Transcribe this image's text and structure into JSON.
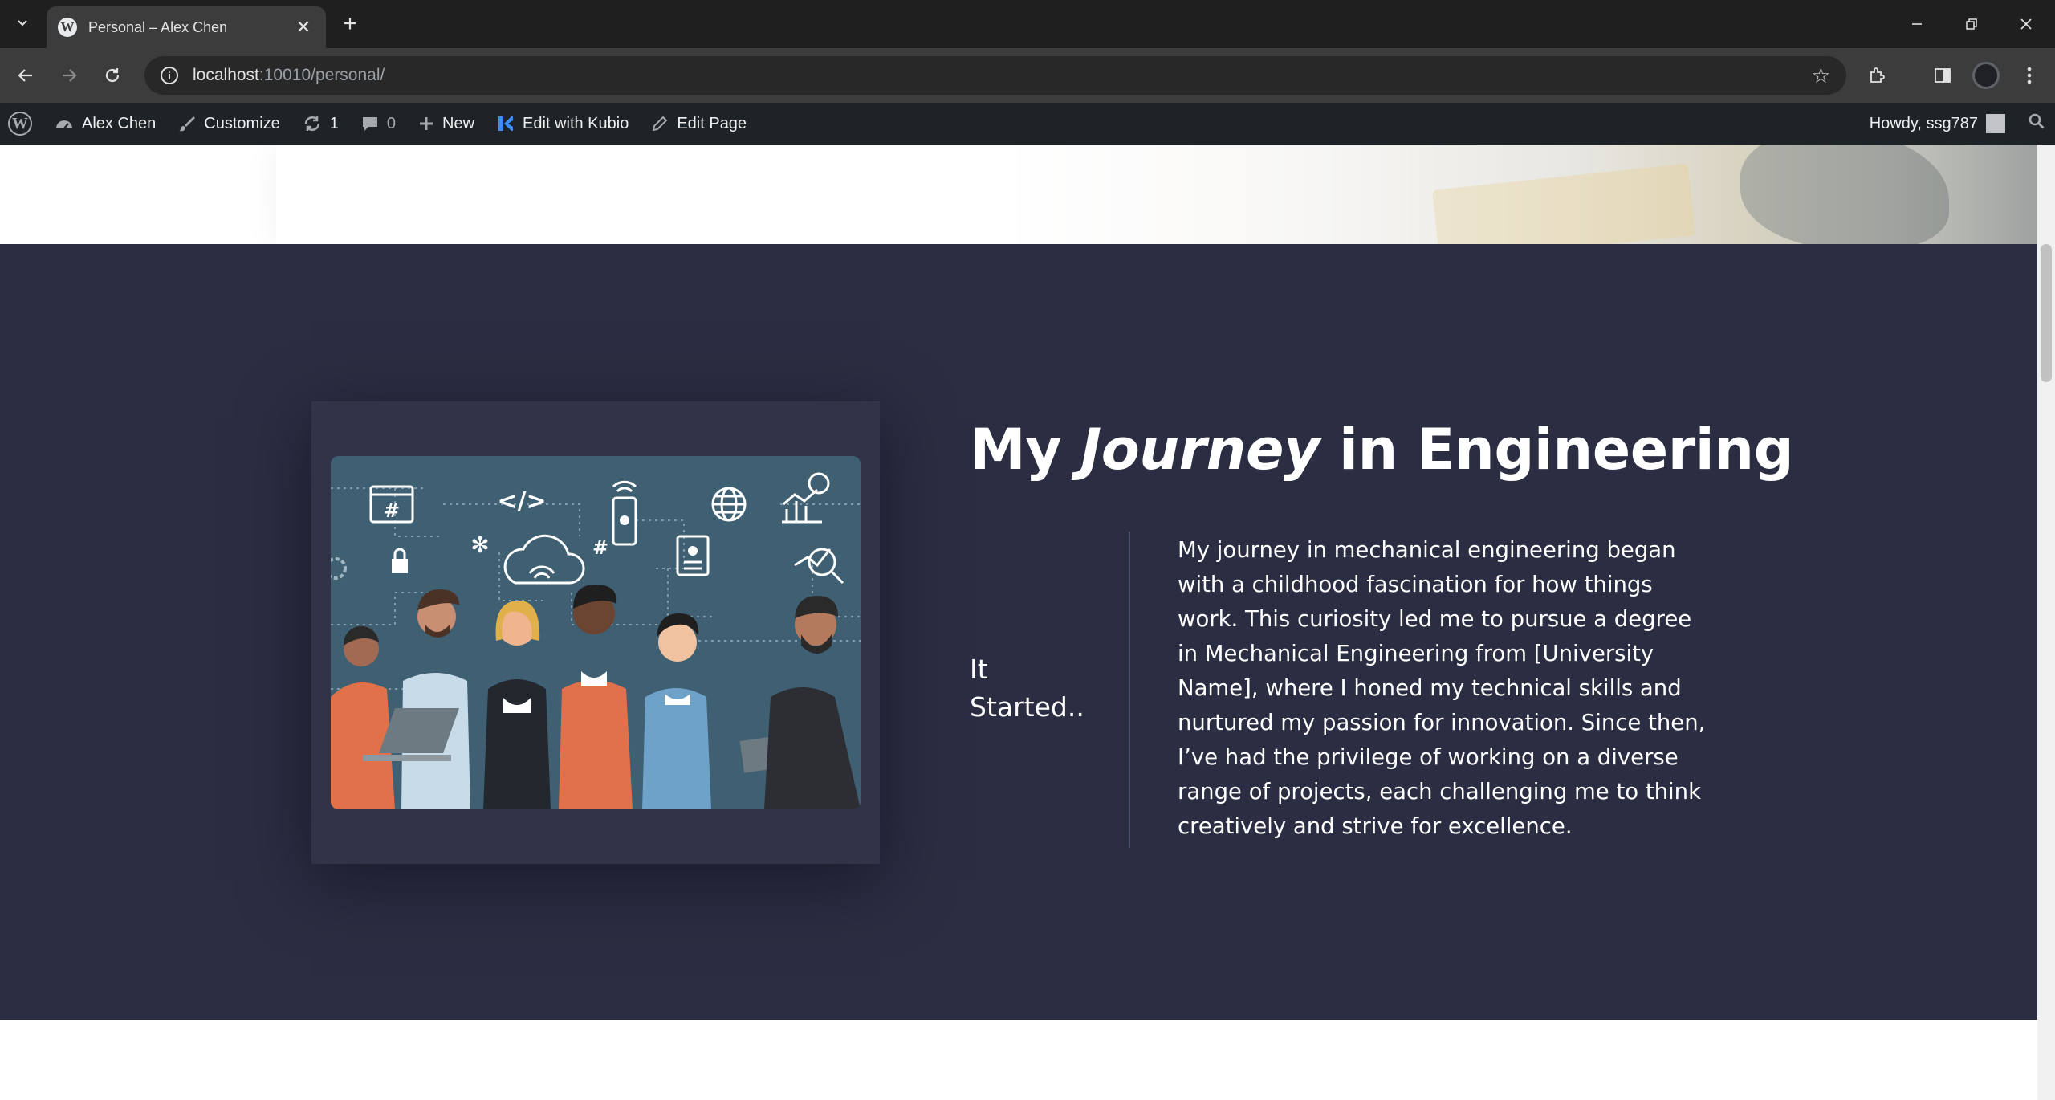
{
  "browser": {
    "tab_title": "Personal – Alex Chen",
    "favicon_letter": "W",
    "url_host": "localhost",
    "url_rest": ":10010/personal/"
  },
  "adminbar": {
    "site_name": "Alex Chen",
    "customize": "Customize",
    "updates_count": "1",
    "comments_count": "0",
    "new_label": "New",
    "kubio_label": "Edit with Kubio",
    "edit_page_label": "Edit Page",
    "howdy": "Howdy, ssg787"
  },
  "section": {
    "heading_pre": "My ",
    "heading_em": "Journey",
    "heading_post": " in Engineering",
    "side_label": "It Started..",
    "paragraph": "My journey in mechanical engineering began with a childhood fascination for how things work. This curiosity led me to pursue a degree in Mechanical Engineering from [University Name], where I honed my technical skills and nurtured my passion for innovation. Since then, I’ve had the privilege of working on a diverse range of projects, each challenging me to think creatively and strive for excellence."
  },
  "illustration": {
    "code_tag": "</>",
    "hash_symbol": "#",
    "hash_symbol_2": "#"
  },
  "colors": {
    "section_bg": "#2b2d42",
    "card_bg": "#313449",
    "illustration_bg": "#3f5f72",
    "admin_bar_bg": "#1d2327"
  }
}
